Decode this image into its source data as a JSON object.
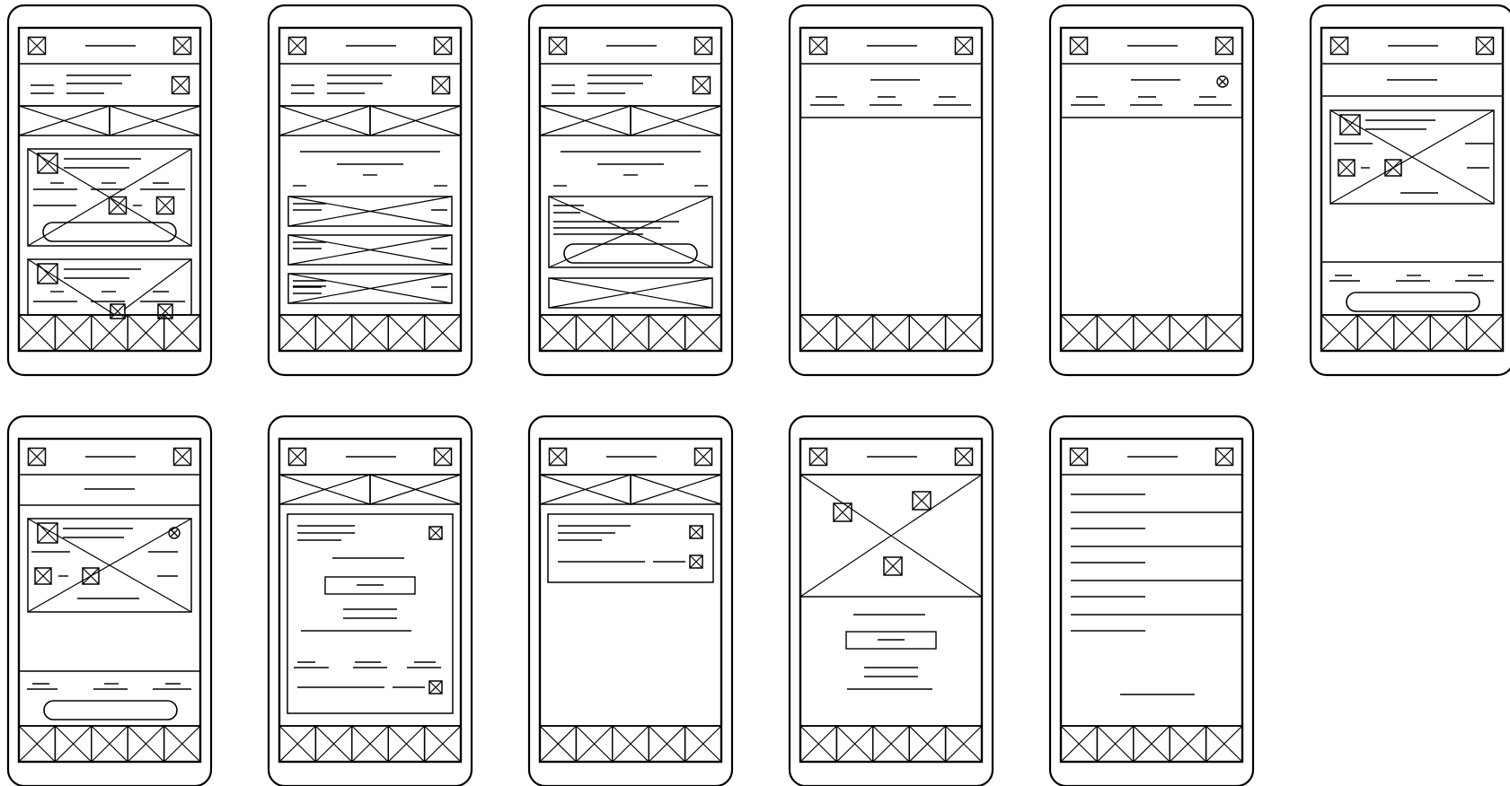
{
  "document": {
    "title": "",
    "wireframe_count": 11,
    "stroke_color": "#000000",
    "background_color": "#ffffff"
  },
  "wireframes": [
    {
      "screen": 1,
      "row": 1,
      "kind": "header-tabs-two-cards-with-buttons",
      "icons": [
        "placeholder-icon",
        "placeholder-icon"
      ]
    },
    {
      "screen": 2,
      "row": 1,
      "kind": "header-tabs-text-list-of-three-image-rows"
    },
    {
      "screen": 3,
      "row": 1,
      "kind": "header-tabs-text-card-with-button"
    },
    {
      "screen": 4,
      "row": 1,
      "kind": "header-three-column-filter-empty-body"
    },
    {
      "screen": 5,
      "row": 1,
      "kind": "header-three-column-filter-with-close-empty-body"
    },
    {
      "screen": 6,
      "row": 1,
      "kind": "header-single-card-footer-with-button"
    },
    {
      "screen": 7,
      "row": 2,
      "kind": "header-single-card-with-close-footer-with-button"
    },
    {
      "screen": 8,
      "row": 2,
      "kind": "header-tabs-form-panel"
    },
    {
      "screen": 9,
      "row": 2,
      "kind": "header-tabs-settings-panel"
    },
    {
      "screen": 10,
      "row": 2,
      "kind": "header-hero-image-with-text-and-button"
    },
    {
      "screen": 11,
      "row": 2,
      "kind": "header-text-list-with-footer-line"
    }
  ]
}
